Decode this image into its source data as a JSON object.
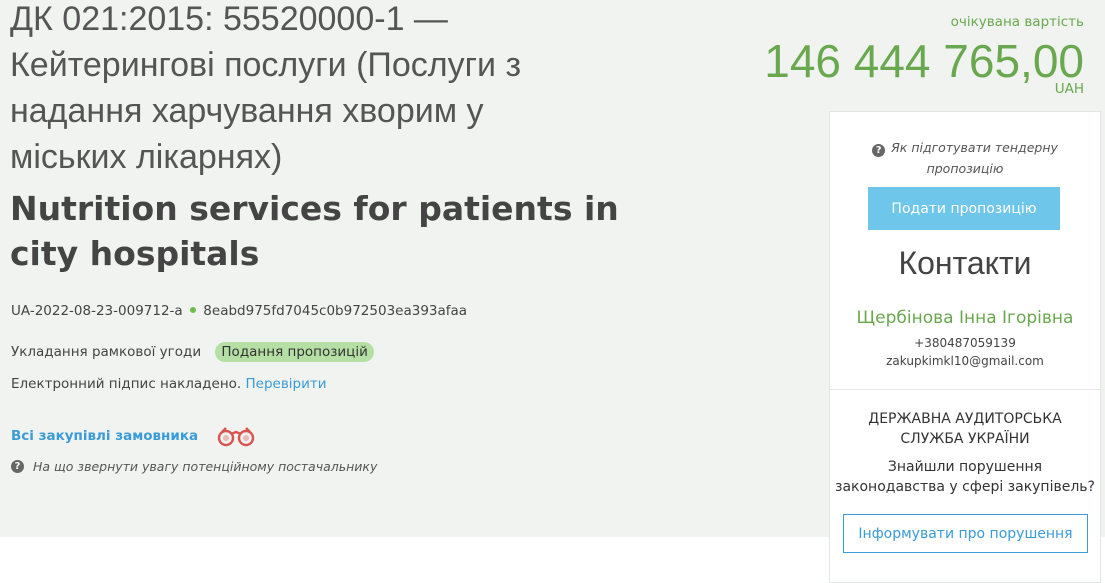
{
  "tender": {
    "title_ua_lines": [
      "ДК 021:2015: 55520000-1 —",
      "Кейтерингові послуги (Послуги з",
      "надання харчування хворим у",
      "міських лікарнях)"
    ],
    "title_en_lines": [
      "Nutrition services for patients in",
      "city hospitals"
    ],
    "id": "UA-2022-08-23-009712-a",
    "hash": "8eabd975fd7045c0b972503ea393afaa",
    "procedure": "Укладання рамкової угоди",
    "status": "Подання пропозицій",
    "signature_text": "Електронний підпис накладено.",
    "signature_link": "Перевірити",
    "all_purchases_link": "Всі закупівлі замовника",
    "attention_text": "На що звернути увагу потенційному постачальнику"
  },
  "expected_value": {
    "label": "очікувана вартість",
    "amount": "146 444 765,00",
    "currency": "UAH"
  },
  "sidebar": {
    "how_to_lines": [
      "Як підготувати тендерну",
      "пропозицію"
    ],
    "submit_button": "Подати пропозицію",
    "contacts_title": "Контакти",
    "contact_name": "Щербінова Інна Ігорівна",
    "contact_phone": "+380487059139",
    "contact_email": "zakupkimkl10@gmail.com",
    "audit_title_lines": [
      "ДЕРЖАВНА АУДИТОРСЬКА",
      "СЛУЖБА УКРАЇНИ"
    ],
    "audit_text_lines": [
      "Знайшли порушення",
      "законодавства у сфері закупівель?"
    ],
    "report_button": "Інформувати про порушення"
  },
  "colors": {
    "accent_green": "#6aa84f",
    "link_blue": "#3a9bd6",
    "badge_green": "#b6dfa5",
    "button_cyan": "#6ec6ea"
  },
  "icons": [
    "help-icon",
    "binoculars-icon",
    "status-dot-icon"
  ]
}
